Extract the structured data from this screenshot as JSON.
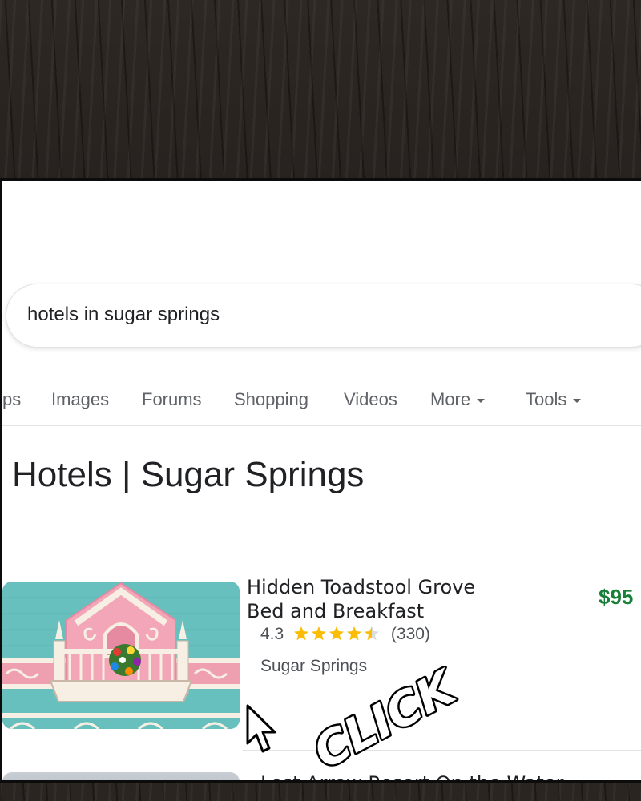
{
  "search": {
    "query": "hotels in sugar springs"
  },
  "tabs": [
    {
      "label": "ps"
    },
    {
      "label": "Images"
    },
    {
      "label": "Forums"
    },
    {
      "label": "Shopping"
    },
    {
      "label": "Videos"
    },
    {
      "label": "More"
    },
    {
      "label": "Tools"
    }
  ],
  "page_title": "Hotels | Sugar Springs",
  "results": [
    {
      "name": "Hidden Toadstool Grove Bed and Breakfast",
      "price": "$95",
      "rating": "4.3",
      "stars": 4.3,
      "reviews": "(330)",
      "location": "Sugar Springs"
    },
    {
      "name": "Lost Arrow Resort On the Water"
    }
  ],
  "overlay": {
    "click_text": "CLICK"
  },
  "colors": {
    "price_green": "#188038",
    "star_gold": "#fbbc04",
    "balcony_pink": "#f4a7b9",
    "wall_teal": "#67c0be"
  },
  "icons": [
    "mouse-cursor-icon",
    "caret-down-icon",
    "star-icon"
  ]
}
